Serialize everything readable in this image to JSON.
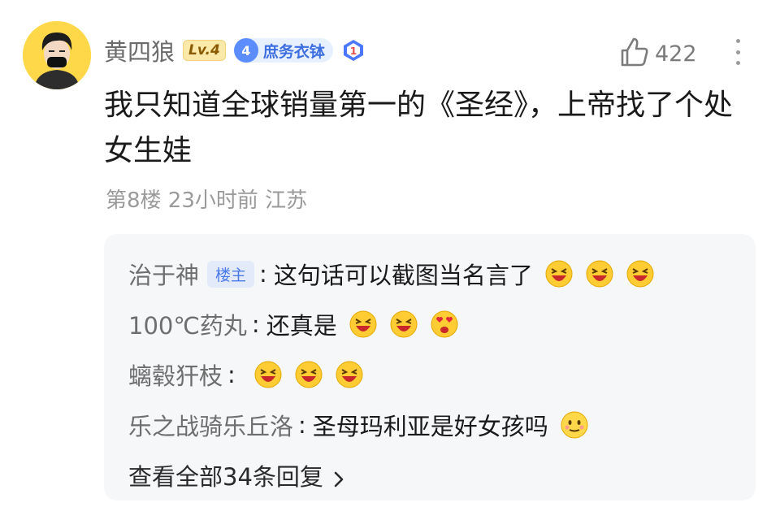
{
  "user": {
    "name": "黄四狼",
    "level": "Lv.4",
    "fan_level": "4",
    "fan_badge": "庶务衣钵",
    "rank_number": "1"
  },
  "like_count": "422",
  "comment_text": "我只知道全球销量第一的《圣经》，上帝找了个处女生娃",
  "meta": "第8楼 23小时前 江苏",
  "owner_tag": "楼主",
  "replies": [
    {
      "name": "治于神",
      "text": "这句话可以截图当名言了",
      "emojis": [
        "laugh-emoji",
        "laugh-emoji",
        "laugh-emoji"
      ]
    },
    {
      "name": "100℃药丸",
      "text": "还真是",
      "emojis": [
        "laugh-emoji",
        "laugh-emoji",
        "heart-eyes-emoji"
      ]
    },
    {
      "name": "螭毂犴枝",
      "text": "",
      "emojis": [
        "laugh-emoji",
        "laugh-emoji",
        "laugh-emoji"
      ]
    },
    {
      "name": "乐之战骑乐丘洛",
      "text": "圣母玛利亚是好女孩吗",
      "emojis": [
        "awkward-smile-emoji"
      ]
    }
  ],
  "view_all": "查看全部34条回复",
  "colors": {
    "avatar_bg": "#ffd84a",
    "fan_badge_blue": "#5b8dff",
    "reply_bg": "#f6f7f9",
    "muted_text": "#9a9a9a"
  }
}
